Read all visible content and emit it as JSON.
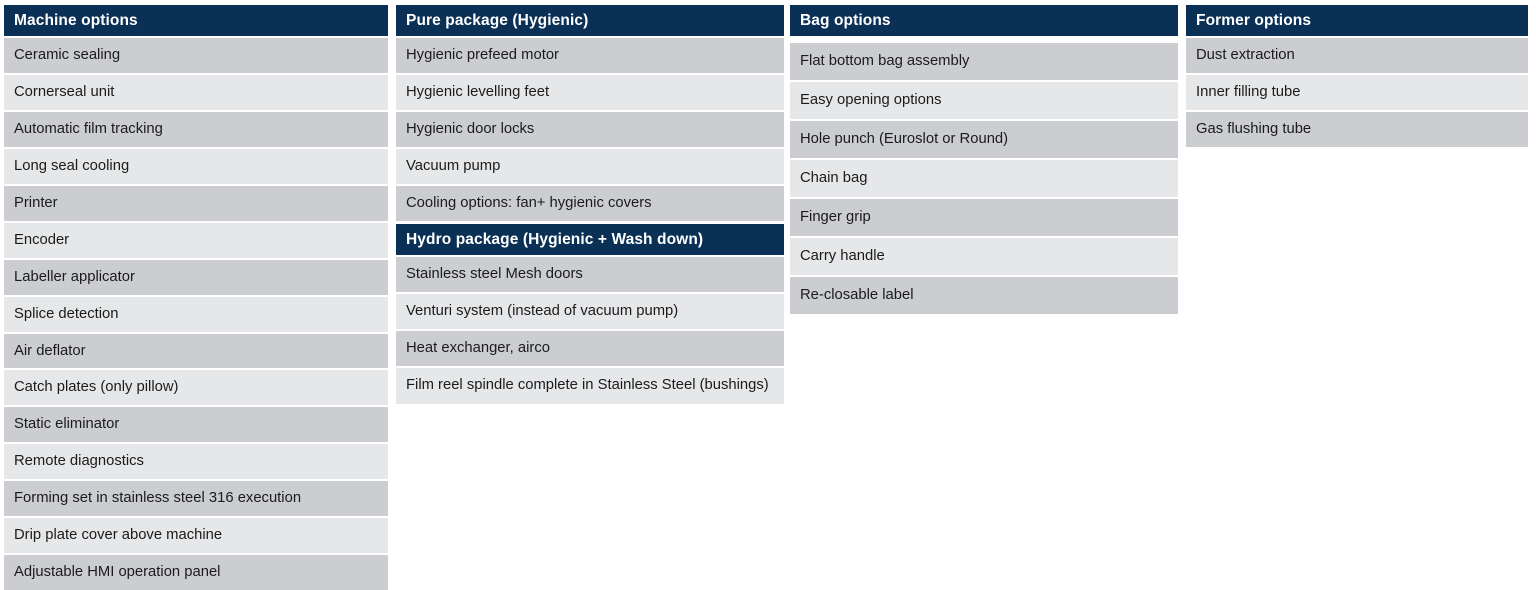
{
  "colors": {
    "header_bg": "#0a3055",
    "header_text": "#ffffff",
    "row_dark": "#cbcdd1",
    "row_light": "#e6e7e9",
    "page_bg": "#ffffff",
    "body_text": "#1b1b1b"
  },
  "columns": [
    {
      "id": "machine-options",
      "sections": [
        {
          "header": "Machine options",
          "rows": [
            "Ceramic sealing",
            "Cornerseal unit",
            "Automatic film tracking",
            "Long seal cooling",
            "Printer",
            "Encoder",
            "Labeller applicator",
            "Splice detection",
            "Air deflator",
            "Catch plates (only pillow)",
            "Static eliminator",
            "Remote diagnostics",
            "Forming set in stainless steel 316 execution",
            "Drip plate cover above machine",
            "Adjustable HMI operation panel"
          ]
        }
      ]
    },
    {
      "id": "pure-package",
      "sections": [
        {
          "header": "Pure package (Hygienic)",
          "rows": [
            "Hygienic prefeed motor",
            "Hygienic levelling feet",
            "Hygienic door locks",
            "Vacuum pump",
            "Cooling options: fan+ hygienic covers"
          ]
        },
        {
          "header": "Hydro package (Hygienic + Wash down)",
          "rows": [
            "Stainless steel Mesh doors",
            "Venturi system (instead of vacuum pump)",
            "Heat exchanger, airco",
            "Film reel spindle complete in Stainless Steel (bushings)"
          ]
        }
      ]
    },
    {
      "id": "bag-options",
      "sections": [
        {
          "header": "Bag options",
          "rows": [
            "Flat bottom bag assembly",
            "Easy opening options",
            "Hole punch (Euroslot or Round)",
            "Chain bag",
            "Finger grip",
            "Carry handle",
            "Re-closable label"
          ]
        }
      ]
    },
    {
      "id": "former-options",
      "sections": [
        {
          "header": "Former options",
          "rows": [
            "Dust extraction",
            "Inner filling tube",
            "Gas flushing tube"
          ]
        }
      ]
    }
  ]
}
